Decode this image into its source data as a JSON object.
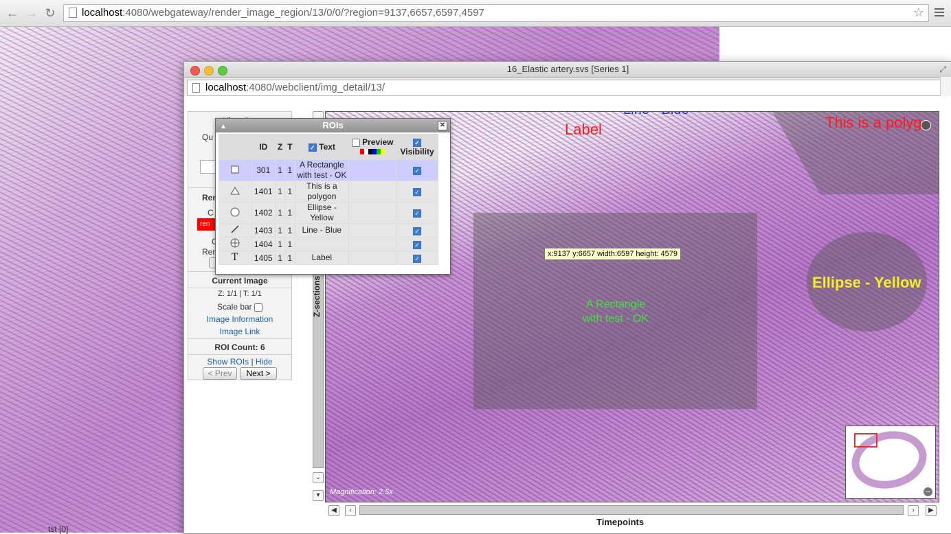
{
  "browser": {
    "url_host": "localhost",
    "url_rest": ":4080/webgateway/render_image_region/13/0/0/?region=9137,6657,6597,4597",
    "back_icon": "back-arrow-icon",
    "forward_icon": "forward-arrow-icon",
    "reload_icon": "reload-icon"
  },
  "background_caption": "tst [0]",
  "popup": {
    "title": "16_Elastic artery.svs [Series 1]",
    "url_host": "localhost",
    "url_rest": ":4080/webclient/img_detail/13/"
  },
  "left_panel": {
    "view_heading": "View Set",
    "quality_label": "Qu",
    "render_heading": "Ren",
    "channel_label": "C",
    "red_swatch_label": "ren",
    "channel2_label": "C",
    "render2_label": "Ren",
    "current_image": "Current Image",
    "zt_info": "Z: 1/1 | T: 1/1",
    "scale_bar": "Scale bar",
    "image_info_link": "Image Information",
    "image_link": "Image Link",
    "roi_count": "ROI Count: 6",
    "show_rois": "Show ROIs",
    "separator": "|",
    "hide": "Hide",
    "prev_button": "< Prev",
    "next_button": "Next >"
  },
  "zsections_label": "Z-sections",
  "timepoints_label": "Timepoints",
  "viewer": {
    "label_text": "Label",
    "line_text": "Line - Blue",
    "polygon_text": "This is a polyg",
    "ellipse_text": "Ellipse - Yellow",
    "rect_text_line1": "A Rectangle",
    "rect_text_line2": "with test - OK",
    "coord_tooltip": "x:9137 y:6657 width:6597 height: 4579",
    "magnification": "Magnification: 2.5x"
  },
  "roi_dialog": {
    "title": "ROIs",
    "headers": {
      "id": "ID",
      "z": "Z",
      "t": "T",
      "text": "Text",
      "preview": "Preview",
      "visibility": "Visibility"
    },
    "preview_colors": [
      "#ff0000",
      "#ffffff",
      "#000000",
      "#0000ff",
      "#00cc00",
      "#ffff00"
    ],
    "rows": [
      {
        "icon": "rectangle-icon",
        "id": "301",
        "z": "1",
        "t": "1",
        "text": "A Rectangle with test - OK",
        "selected": true
      },
      {
        "icon": "polygon-icon",
        "id": "1401",
        "z": "1",
        "t": "1",
        "text": "This is a polygon",
        "selected": false
      },
      {
        "icon": "ellipse-icon",
        "id": "1402",
        "z": "1",
        "t": "1",
        "text": "Ellipse - Yellow",
        "selected": false
      },
      {
        "icon": "line-icon",
        "id": "1403",
        "z": "1",
        "t": "1",
        "text": "Line - Blue",
        "selected": false
      },
      {
        "icon": "point-icon",
        "id": "1404",
        "z": "1",
        "t": "1",
        "text": "",
        "selected": false
      },
      {
        "icon": "text-icon",
        "id": "1405",
        "z": "1",
        "t": "1",
        "text": "Label",
        "selected": false
      }
    ]
  }
}
